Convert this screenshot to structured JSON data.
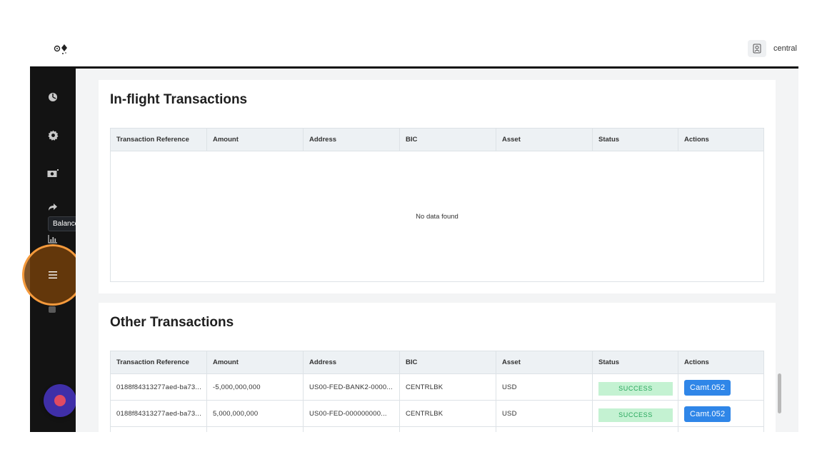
{
  "header": {
    "user_name": "central"
  },
  "sidebar": {
    "items": [
      {
        "icon": "dashboard-icon"
      },
      {
        "icon": "gear-icon"
      },
      {
        "icon": "money-icon"
      },
      {
        "icon": "share-arrow-icon"
      },
      {
        "icon": "bar-chart-icon"
      },
      {
        "icon": "list-icon"
      },
      {
        "icon": "hand-icon"
      }
    ],
    "tooltip": "Balances"
  },
  "inflight": {
    "title": "In-flight Transactions",
    "columns": [
      "Transaction Reference",
      "Amount",
      "Address",
      "BIC",
      "Asset",
      "Status",
      "Actions"
    ],
    "empty_text": "No data found"
  },
  "other": {
    "title": "Other Transactions",
    "columns": [
      "Transaction Reference",
      "Amount",
      "Address",
      "BIC",
      "Asset",
      "Status",
      "Actions"
    ],
    "rows": [
      {
        "ref": "0188f84313277aed-ba73...",
        "amount": "-5,000,000,000",
        "address": "US00-FED-BANK2-0000...",
        "bic": "CENTRLBK",
        "asset": "USD",
        "status": "SUCCESS",
        "action": "Camt.052"
      },
      {
        "ref": "0188f84313277aed-ba73...",
        "amount": "5,000,000,000",
        "address": "US00-FED-000000000...",
        "bic": "CENTRLBK",
        "asset": "USD",
        "status": "SUCCESS",
        "action": "Camt.052"
      }
    ]
  },
  "colors": {
    "accent": "#2f86e8",
    "success_bg": "#c4f2d2",
    "success_text": "#25a55a",
    "highlight_ring": "#f59a3c",
    "fab": "#3f2fa8"
  }
}
